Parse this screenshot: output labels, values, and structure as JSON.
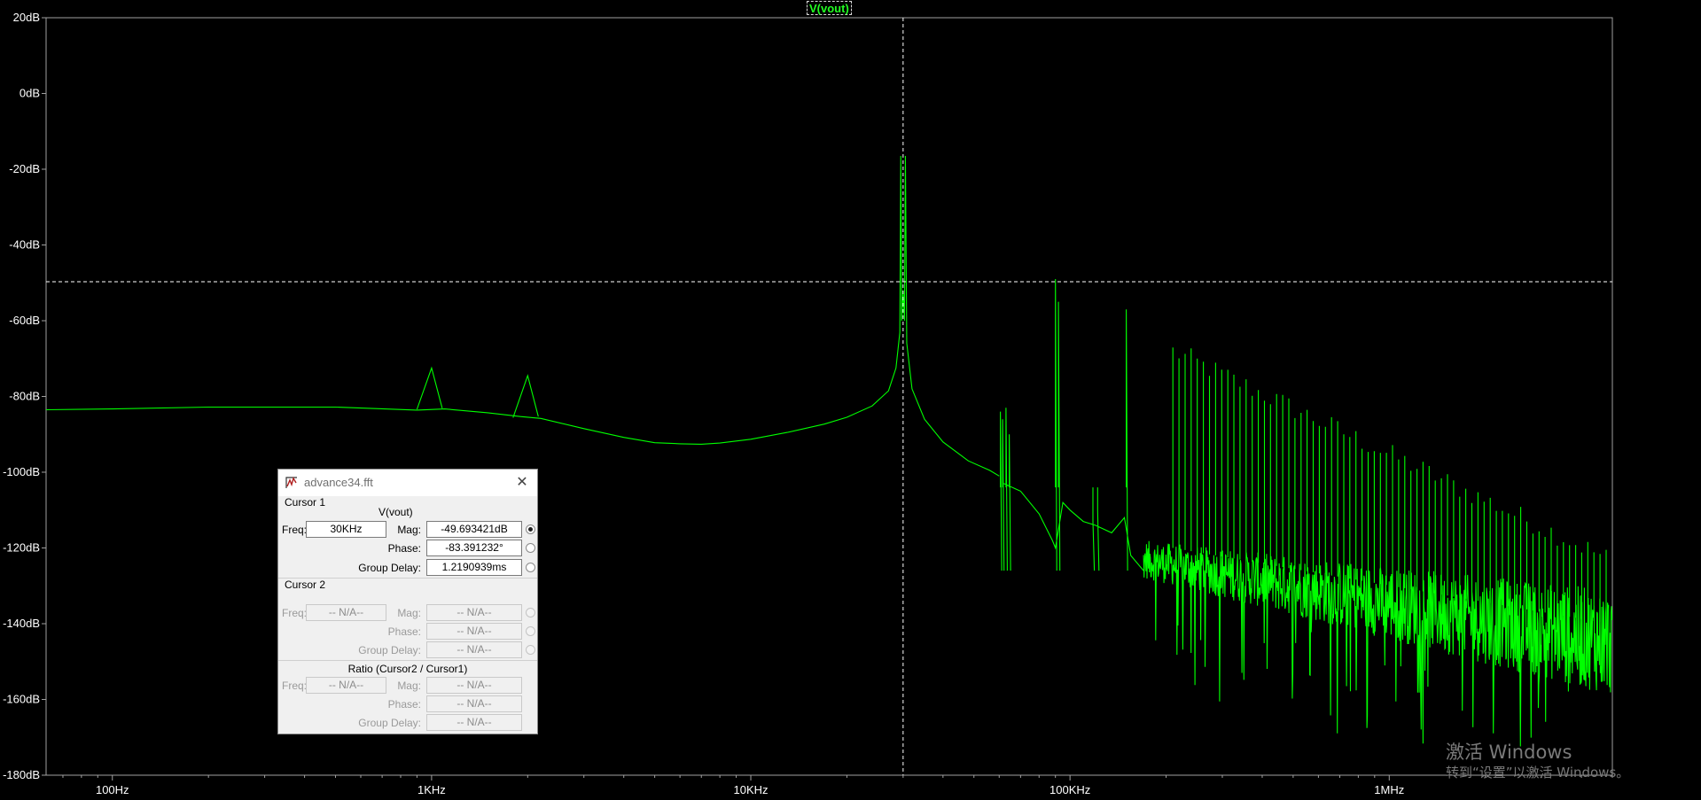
{
  "window": {
    "trace_title": "V(vout)",
    "colors": {
      "background": "#000000",
      "trace": "#00ff00",
      "axis": "#a0a0a0",
      "cursor": "#ffffff"
    }
  },
  "chart_data": {
    "type": "line",
    "x_scale": "log",
    "xlim": [
      62,
      5000000
    ],
    "ylim": [
      -180,
      20
    ],
    "x_ticks": [
      {
        "value": 100,
        "label": "100Hz"
      },
      {
        "value": 1000,
        "label": "1KHz"
      },
      {
        "value": 10000,
        "label": "10KHz"
      },
      {
        "value": 100000,
        "label": "100KHz"
      },
      {
        "value": 1000000,
        "label": "1MHz"
      }
    ],
    "y_ticks": [
      {
        "value": 20,
        "label": "20dB"
      },
      {
        "value": 0,
        "label": "0dB"
      },
      {
        "value": -20,
        "label": "-20dB"
      },
      {
        "value": -40,
        "label": "-40dB"
      },
      {
        "value": -60,
        "label": "-60dB"
      },
      {
        "value": -80,
        "label": "-80dB"
      },
      {
        "value": -100,
        "label": "-100dB"
      },
      {
        "value": -120,
        "label": "-120dB"
      },
      {
        "value": -140,
        "label": "-140dB"
      },
      {
        "value": -160,
        "label": "-160dB"
      },
      {
        "value": -180,
        "label": "-180dB"
      }
    ],
    "grid": false,
    "series": [
      {
        "name": "V(vout)",
        "baseline": [
          [
            62,
            -83.5
          ],
          [
            100,
            -83.3
          ],
          [
            200,
            -82.8
          ],
          [
            500,
            -82.8
          ],
          [
            900,
            -83.6
          ],
          [
            1100,
            -83.3
          ],
          [
            1500,
            -84.3
          ],
          [
            1900,
            -85.3
          ],
          [
            2200,
            -85.8
          ],
          [
            3000,
            -88.5
          ],
          [
            4000,
            -90.8
          ],
          [
            5000,
            -92.2
          ],
          [
            6000,
            -92.5
          ],
          [
            7000,
            -92.6
          ],
          [
            8000,
            -92.3
          ],
          [
            10000,
            -91.3
          ],
          [
            13000,
            -89.5
          ],
          [
            17000,
            -87.3
          ],
          [
            20000,
            -85.5
          ],
          [
            24000,
            -82.5
          ],
          [
            27000,
            -78.5
          ],
          [
            28500,
            -72.5
          ],
          [
            29300,
            -63
          ]
        ],
        "peaks": [
          {
            "freq": 1000,
            "level": -72.5
          },
          {
            "freq": 2000,
            "level": -74.5
          },
          {
            "freq": 29500,
            "level": -16.5
          },
          {
            "freq": 30000,
            "level": -52
          },
          {
            "freq": 30500,
            "level": -16.5
          }
        ]
      }
    ],
    "cursor": {
      "freq": 30000,
      "level": -49.693421
    }
  },
  "dialog": {
    "title": "advance34.fft",
    "cursor1": {
      "header": "Cursor 1",
      "trace": "V(vout)",
      "freq_label": "Freq:",
      "freq": "30KHz",
      "mag_label": "Mag:",
      "mag": "-49.693421dB",
      "phase_label": "Phase:",
      "phase": "-83.391232°",
      "gd_label": "Group Delay:",
      "gd": "1.2190939ms"
    },
    "cursor2": {
      "header": "Cursor 2",
      "freq_label": "Freq:",
      "freq": "-- N/A--",
      "mag_label": "Mag:",
      "mag": "-- N/A--",
      "phase_label": "Phase:",
      "phase": "-- N/A--",
      "gd_label": "Group Delay:",
      "gd": "-- N/A--"
    },
    "ratio": {
      "header": "Ratio (Cursor2 / Cursor1)",
      "freq_label": "Freq:",
      "freq": "-- N/A--",
      "mag_label": "Mag:",
      "mag": "-- N/A--",
      "phase_label": "Phase:",
      "phase": "-- N/A--",
      "gd_label": "Group Delay:",
      "gd": "-- N/A--"
    }
  },
  "watermark": {
    "line1": "激活 Windows",
    "line2": "转到“设置”以激活 Windows。"
  }
}
